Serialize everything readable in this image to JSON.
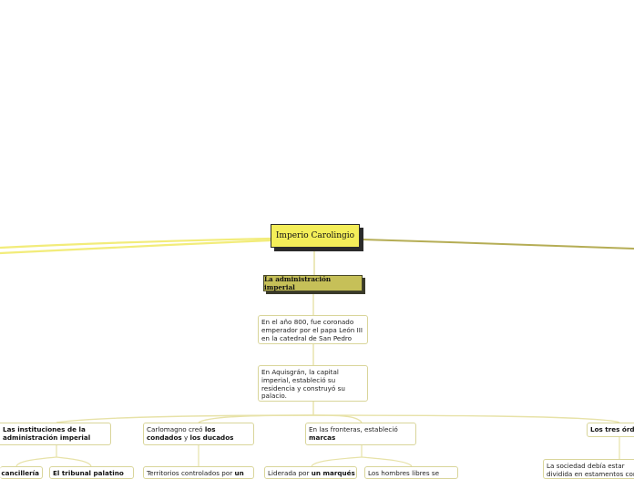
{
  "central": {
    "label": "Imperio Carolingio"
  },
  "main_topic": {
    "label": "La administración imperial"
  },
  "sub1": {
    "text": "En el año 800, fue coronado emperador por el papa León III en la catedral de San Pedro"
  },
  "sub2": {
    "text": "En Aquisgrán, la capital imperial, estableció su residencia y construyó su palacio."
  },
  "branch_instituciones": {
    "text": "Las instituciones de la administración imperial"
  },
  "branch_condados": {
    "pre": "Carlomagno creó ",
    "bold1": "los condados",
    "mid": " y ",
    "bold2": "los ducados"
  },
  "branch_marcas": {
    "pre": "En las fronteras, estableció ",
    "bold": "marcas"
  },
  "branch_ordenes": {
    "text": "Los tres órdenes"
  },
  "leaf_cancilleria": {
    "text": "La cancillería"
  },
  "leaf_tribunal": {
    "text": "El tribunal palatino"
  },
  "leaf_territorios": {
    "pre": "Territorios controlados por ",
    "bold": "un"
  },
  "leaf_marques": {
    "pre": "Liderada por ",
    "bold": "un marqués"
  },
  "leaf_hombres": {
    "text": "Los hombres libres se"
  },
  "leaf_sociedad": {
    "text": "La sociedad debía estar dividida en estamentos con sus propias"
  },
  "colors": {
    "central_fill": "#f4ee59",
    "main_fill": "#c6c058",
    "link": "#e7e2a8",
    "link_left": "#f2ec7a",
    "link_right": "#b5ad55"
  }
}
